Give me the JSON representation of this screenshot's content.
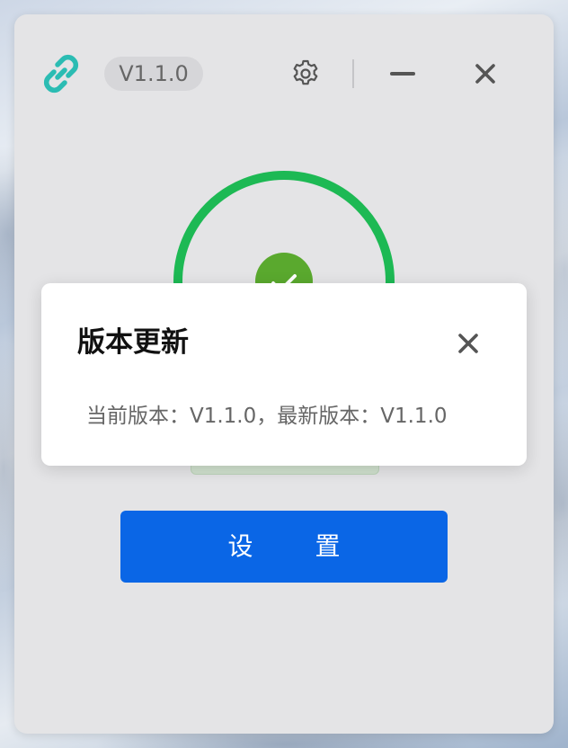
{
  "app": {
    "version_badge": "V1.1.0"
  },
  "status": {
    "state": "connected",
    "ring_color": "#1db954",
    "check_color": "#5aa92e"
  },
  "main": {
    "settings_button_label": "设 置"
  },
  "dialog": {
    "title": "版本更新",
    "message": "当前版本：V1.1.0，最新版本：V1.1.0"
  },
  "colors": {
    "accent": "#0a66e6",
    "logo": "#2bbcb3"
  },
  "icons": {
    "logo": "link-icon",
    "settings": "gear-icon",
    "minimize": "minimize-icon",
    "close": "close-icon",
    "status": "check-icon"
  }
}
